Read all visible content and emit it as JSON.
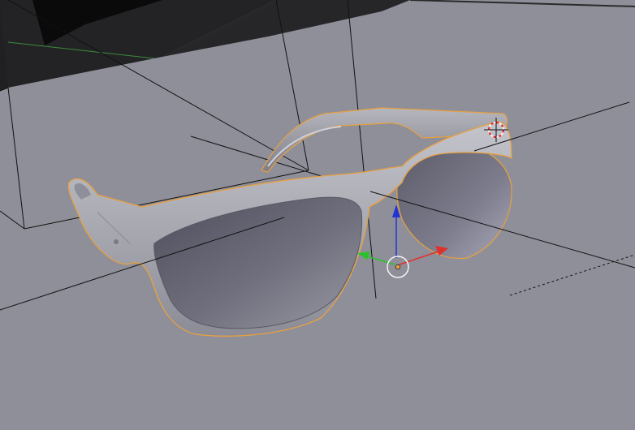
{
  "viewport": {
    "background_color": "#8f8f99",
    "selection_outline_color": "#e8a040",
    "frame_color": "#6c6c74",
    "glasses_color": "#a4a4ae",
    "lens_color": "#6e6e7a"
  },
  "scene_objects": {
    "camera": "camera-object",
    "model": "sunglasses-mesh",
    "cursor": "3d-cursor-icon"
  },
  "gizmo": {
    "axes": [
      "x-axis-red",
      "y-axis-green",
      "z-axis-blue"
    ],
    "x_color": "#e0302c",
    "y_color": "#29c22b",
    "z_color": "#2334d6",
    "origin_color": "#e8a040"
  }
}
